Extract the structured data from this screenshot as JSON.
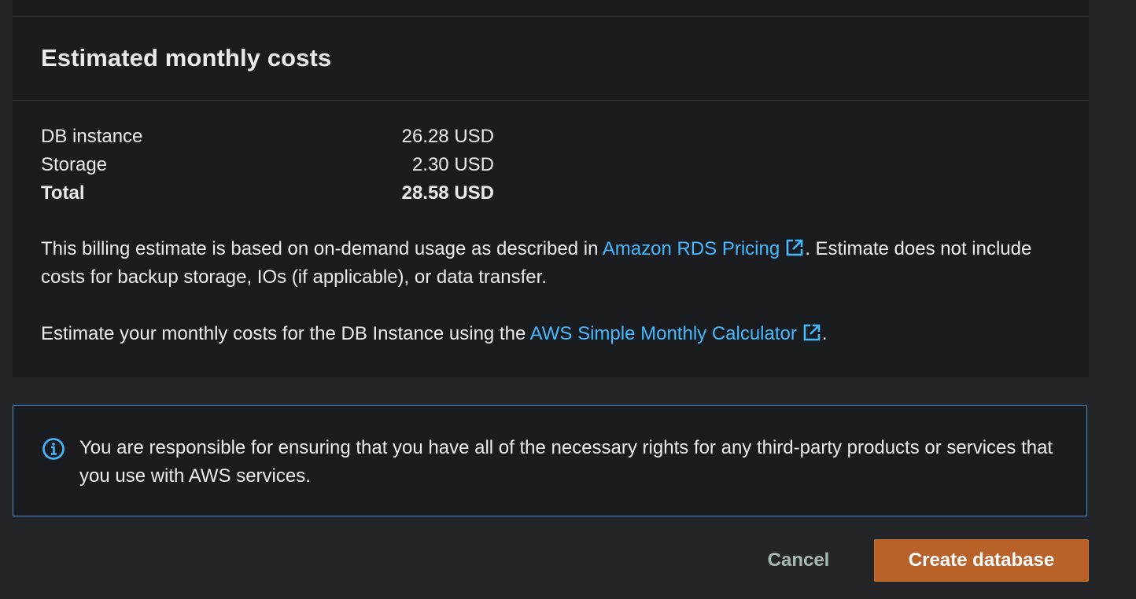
{
  "cost_panel": {
    "title": "Estimated monthly costs",
    "rows": [
      {
        "label": "DB instance",
        "value": "26.28 USD"
      },
      {
        "label": "Storage",
        "value": "2.30 USD"
      },
      {
        "label": "Total",
        "value": "28.58 USD"
      }
    ],
    "billing_note": {
      "prefix": "This billing estimate is based on on-demand usage as described in ",
      "link_text": "Amazon RDS Pricing",
      "suffix": ". Estimate does not include costs for backup storage, IOs (if applicable), or data transfer."
    },
    "calculator_note": {
      "prefix": "Estimate your monthly costs for the DB Instance using the ",
      "link_text": "AWS Simple Monthly Calculator",
      "suffix": "."
    }
  },
  "info_alert": {
    "icon": "info-icon",
    "text": "You are responsible for ensuring that you have all of the necessary rights for any third-party products or services that you use with AWS services."
  },
  "actions": {
    "cancel_label": "Cancel",
    "create_label": "Create database"
  },
  "colors": {
    "link": "#44b9ff",
    "primary_button": "#b8622a",
    "info_border": "#4a8fce"
  }
}
